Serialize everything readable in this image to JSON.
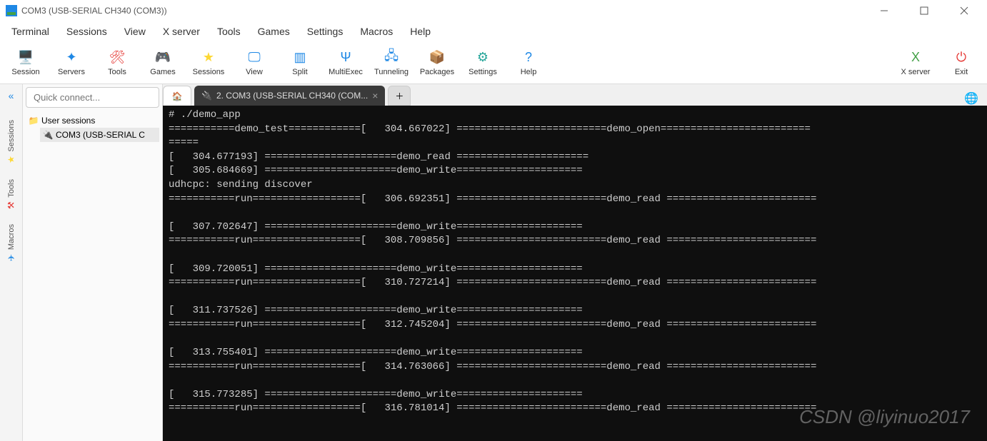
{
  "window": {
    "title": "COM3  (USB-SERIAL CH340 (COM3))"
  },
  "menu": {
    "items": [
      "Terminal",
      "Sessions",
      "View",
      "X server",
      "Tools",
      "Games",
      "Settings",
      "Macros",
      "Help"
    ]
  },
  "toolbar": {
    "left": [
      {
        "label": "Session",
        "iconColor": "#1e88e5",
        "glyph": "🖥️"
      },
      {
        "label": "Servers",
        "iconColor": "#1e88e5",
        "glyph": "✦"
      },
      {
        "label": "Tools",
        "iconColor": "#e53935",
        "glyph": "🛠"
      },
      {
        "label": "Games",
        "iconColor": "#fb8c00",
        "glyph": "🎮"
      },
      {
        "label": "Sessions",
        "iconColor": "#fdd835",
        "glyph": "★"
      },
      {
        "label": "View",
        "iconColor": "#1e88e5",
        "glyph": "🖵"
      },
      {
        "label": "Split",
        "iconColor": "#1e88e5",
        "glyph": "▥"
      },
      {
        "label": "MultiExec",
        "iconColor": "#1e88e5",
        "glyph": "Ψ"
      },
      {
        "label": "Tunneling",
        "iconColor": "#1e88e5",
        "glyph": "🖧"
      },
      {
        "label": "Packages",
        "iconColor": "#8d6e63",
        "glyph": "📦"
      },
      {
        "label": "Settings",
        "iconColor": "#26a69a",
        "glyph": "⚙"
      },
      {
        "label": "Help",
        "iconColor": "#1e88e5",
        "glyph": "?"
      }
    ],
    "right": [
      {
        "label": "X server",
        "iconColor": "#43a047",
        "glyph": "X"
      },
      {
        "label": "Exit",
        "iconColor": "#e53935",
        "glyph": "⏻"
      }
    ]
  },
  "sidebar": {
    "quick_connect_placeholder": "Quick connect...",
    "root_label": "User sessions",
    "child_label": "COM3  (USB-SERIAL C"
  },
  "rail": {
    "items": [
      "Sessions",
      "Tools",
      "Macros"
    ]
  },
  "tabs": {
    "active_label": "2. COM3  (USB-SERIAL CH340 (COM..."
  },
  "terminal_lines": [
    "# ./demo_app",
    "===========demo_test============[   304.667022] =========================demo_open=========================",
    "=====",
    "[   304.677193] ======================demo_read ======================",
    "[   305.684669] ======================demo_write=====================",
    "udhcpc: sending discover",
    "===========run==================[   306.692351] =========================demo_read =========================",
    "",
    "[   307.702647] ======================demo_write=====================",
    "===========run==================[   308.709856] =========================demo_read =========================",
    "",
    "[   309.720051] ======================demo_write=====================",
    "===========run==================[   310.727214] =========================demo_read =========================",
    "",
    "[   311.737526] ======================demo_write=====================",
    "===========run==================[   312.745204] =========================demo_read =========================",
    "",
    "[   313.755401] ======================demo_write=====================",
    "===========run==================[   314.763066] =========================demo_read =========================",
    "",
    "[   315.773285] ======================demo_write=====================",
    "===========run==================[   316.781014] =========================demo_read ========================="
  ],
  "watermark": "CSDN @liyinuo2017"
}
